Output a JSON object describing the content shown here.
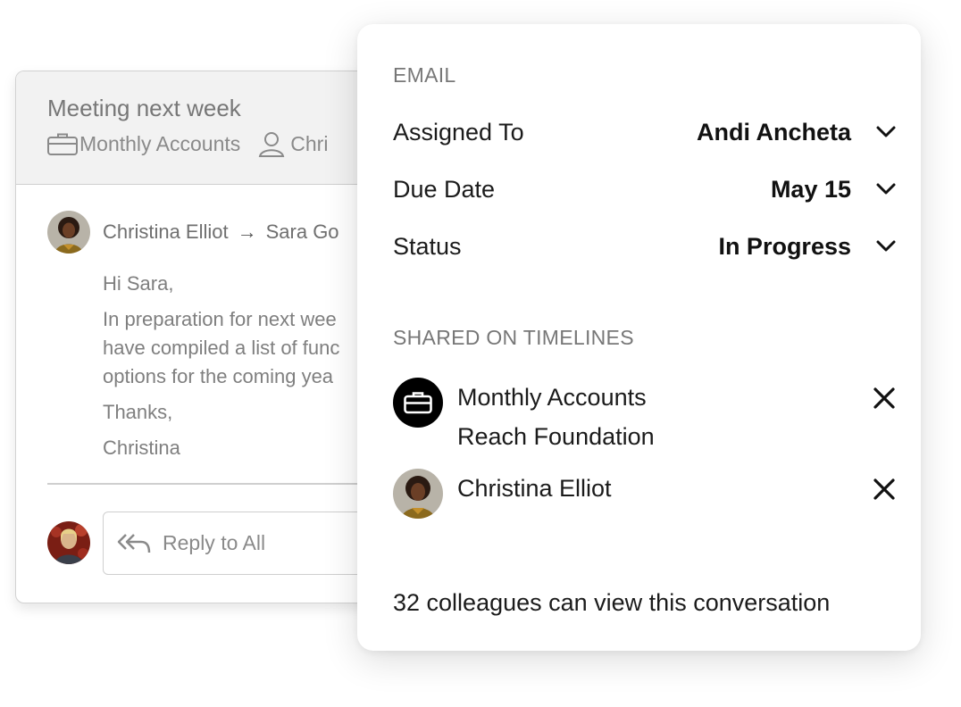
{
  "email": {
    "subject": "Meeting next week",
    "timeline": "Monthly Accounts",
    "contact": "Chri",
    "from": "Christina Elliot",
    "arrow": "→",
    "to": "Sara Go",
    "greeting": "Hi Sara,",
    "body_lines": [
      "In preparation for next wee",
      "have compiled a list of func",
      "options for the coming yea"
    ],
    "signoff": "Thanks,",
    "signature": "Christina",
    "reply_placeholder": "Reply to All"
  },
  "panel": {
    "section_email": "EMAIL",
    "assigned_label": "Assigned To",
    "assigned_value": "Andi Ancheta",
    "due_label": "Due Date",
    "due_value": "May 15",
    "status_label": "Status",
    "status_value": "In Progress",
    "section_shared": "SHARED ON TIMELINES",
    "timelines": [
      {
        "line1": "Monthly Accounts",
        "line2": "Reach Foundation",
        "icon": "briefcase-icon"
      },
      {
        "line1": "Christina Elliot",
        "line2": "",
        "icon": "avatar"
      }
    ],
    "footer": "32 colleagues can view this conversation"
  },
  "colors": {
    "header_bg": "#f2f2f2",
    "muted_text": "#7f7f7f",
    "primary_text": "#111111"
  }
}
